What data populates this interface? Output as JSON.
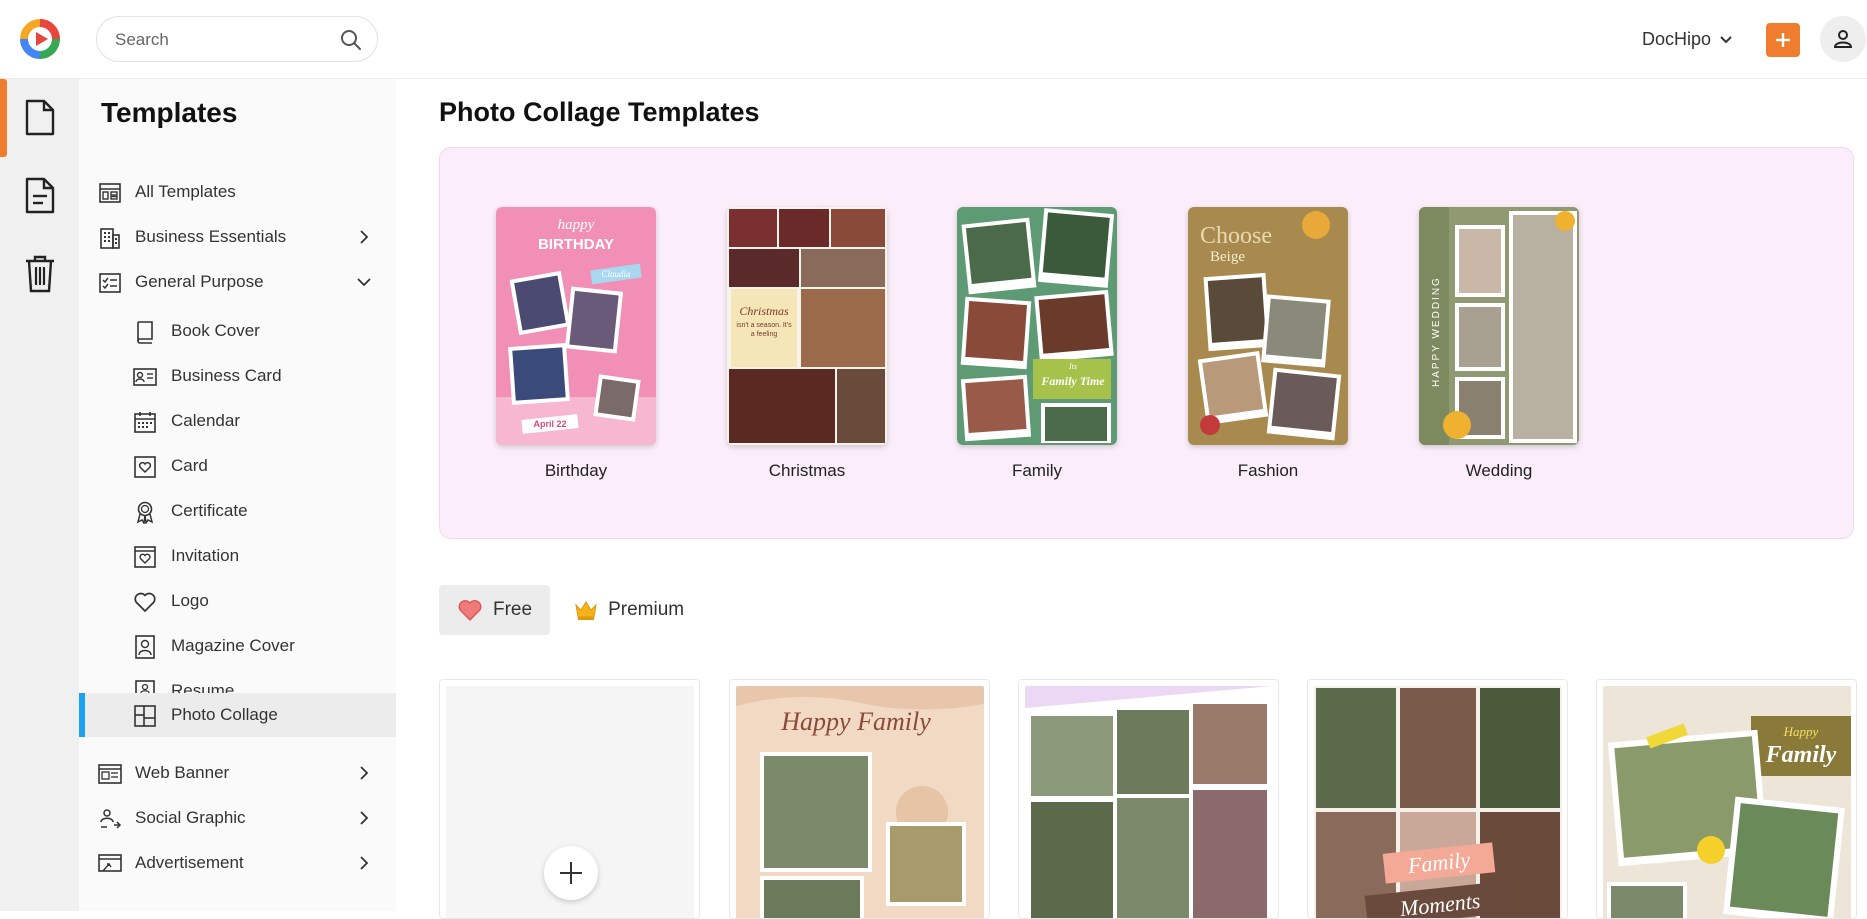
{
  "app": {
    "brand_menu": "DocHipo"
  },
  "search": {
    "placeholder": "Search"
  },
  "sidebar": {
    "title": "Templates",
    "items": [
      {
        "label": "All Templates",
        "icon": "layout-icon"
      },
      {
        "label": "Business Essentials",
        "icon": "building-icon",
        "chevron": "right"
      },
      {
        "label": "General Purpose",
        "icon": "checklist-icon",
        "chevron": "down"
      }
    ],
    "subitems": [
      {
        "label": "Book Cover",
        "icon": "book-icon"
      },
      {
        "label": "Business Card",
        "icon": "id-card-icon"
      },
      {
        "label": "Calendar",
        "icon": "calendar-icon"
      },
      {
        "label": "Card",
        "icon": "heart-card-icon"
      },
      {
        "label": "Certificate",
        "icon": "ribbon-icon"
      },
      {
        "label": "Invitation",
        "icon": "invitation-icon"
      },
      {
        "label": "Logo",
        "icon": "heart-icon"
      },
      {
        "label": "Magazine Cover",
        "icon": "portrait-icon"
      },
      {
        "label": "Resume",
        "icon": "resume-icon"
      },
      {
        "label": "Photo Collage",
        "icon": "collage-icon",
        "active": true
      }
    ],
    "bottom_items": [
      {
        "label": "Web Banner",
        "icon": "banner-icon",
        "chevron": "right"
      },
      {
        "label": "Social Graphic",
        "icon": "social-icon",
        "chevron": "right"
      },
      {
        "label": "Advertisement",
        "icon": "ad-icon",
        "chevron": "right"
      }
    ]
  },
  "main": {
    "title": "Photo Collage Templates",
    "categories": [
      {
        "label": "Birthday",
        "thumb_title": "happy",
        "thumb_sub": "BIRTHDAY",
        "thumb_name": "Claudia",
        "thumb_date": "April 22",
        "color": "#f28fb6"
      },
      {
        "label": "Christmas",
        "thumb_title": "Christmas",
        "thumb_sub": "isn't a season. It's a feeling",
        "color": "#f5e6b8"
      },
      {
        "label": "Family",
        "thumb_title": "Family Time",
        "thumb_sub": "Its",
        "color": "#5e9a73"
      },
      {
        "label": "Fashion",
        "thumb_title": "Choose",
        "thumb_sub": "Beige",
        "color": "#a88a4e"
      },
      {
        "label": "Wedding",
        "thumb_title": "HAPPY WEDDING",
        "color": "#8f9a72"
      }
    ],
    "filters": [
      {
        "label": "Free",
        "icon": "heart-filled-icon",
        "active": true
      },
      {
        "label": "Premium",
        "icon": "crown-icon",
        "active": false
      }
    ],
    "templates": [
      {
        "kind": "blank"
      },
      {
        "title": "Happy Family",
        "bg": "#f2d9c4"
      },
      {
        "title": "",
        "bg": "#ecd7f5"
      },
      {
        "title": "Family",
        "sub": "Moments",
        "bg": "#6a4a3c"
      },
      {
        "title": "Happy",
        "sub": "Family",
        "bg": "#ede5d8"
      }
    ]
  }
}
